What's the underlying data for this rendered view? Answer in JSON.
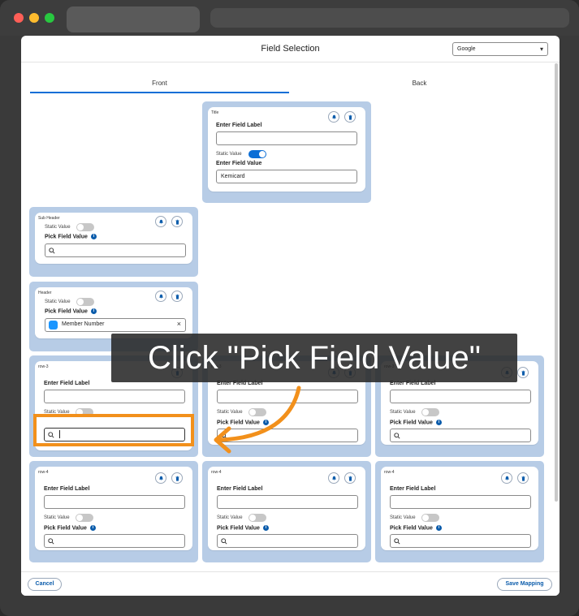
{
  "modal": {
    "title": "Field Selection",
    "select_value": "Google",
    "tabs": [
      "Front",
      "Back"
    ]
  },
  "labels": {
    "enter_label": "Enter Field Label",
    "enter_value": "Enter Field Value",
    "static_value": "Static Value",
    "pick_value": "Pick Field Value",
    "info": "i"
  },
  "cards": {
    "title_card": {
      "name": "Title",
      "static_on": true,
      "value": "Kemicard"
    },
    "sub_header": {
      "name": "Sub Header",
      "static_on": false
    },
    "header": {
      "name": "Header",
      "static_on": false,
      "picked_value": "Member Number"
    },
    "row3": [
      "row-3",
      "row-3",
      "row-3"
    ],
    "row4": [
      "row-4",
      "row-4",
      "row-4"
    ]
  },
  "footer": {
    "cancel": "Cancel",
    "save": "Save Mapping"
  },
  "overlay": {
    "instruction": "Click \"Pick Field Value\""
  },
  "colors": {
    "accent": "#0b6ed6",
    "block_bg": "#b7cce6",
    "highlight": "#f2901b"
  },
  "icons": [
    "bell-icon",
    "trash-icon",
    "search-icon",
    "chevron-down-icon",
    "close-icon"
  ]
}
